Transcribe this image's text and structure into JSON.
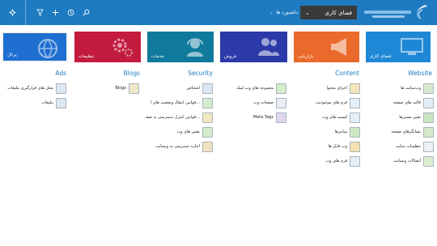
{
  "topbar": {
    "workspace_label": "فضای کاری",
    "dashboards_label": "داشبورد ها",
    "icons": [
      "settings-icon",
      "filter-icon",
      "add-icon",
      "history-icon",
      "search-icon"
    ],
    "colors": {
      "bar": "#1f7bc1",
      "workspace": "#3a3a3a"
    }
  },
  "tiles": [
    {
      "label": "فضای کاری",
      "color": "#1e88d6",
      "icon": "monitor-icon"
    },
    {
      "label": "بازاریابی",
      "color": "#ea6a2c",
      "icon": "megaphone-icon"
    },
    {
      "label": "فروش",
      "color": "#2b3aa8",
      "icon": "users-icon"
    },
    {
      "label": "خدمات",
      "color": "#0f7a9c",
      "icon": "headset-icon"
    },
    {
      "label": "تنظیمات",
      "color": "#c21b3e",
      "icon": "gears-icon"
    },
    {
      "label": "پرتال",
      "color": "#1e6fd0",
      "icon": "portal-icon"
    }
  ],
  "sections": {
    "website": {
      "title": "Website",
      "items": [
        "وب‌سایت ها",
        "قالب های صفحه",
        "تغییر مسیرها",
        "نشانگرهای صفحه",
        "تنظیمات سایت",
        "اتصالات وبسایت"
      ]
    },
    "content": {
      "title": "Content",
      "items": [
        "اجزای محتوا",
        "فرم های موجودیت",
        "لیست های وب",
        "میانبرها",
        "وب فایل ها",
        "فرم های وب"
      ],
      "items2": [
        "مجموعه های وب لینک",
        "صفحات وب",
        "Meta Tags"
      ]
    },
    "security": {
      "title": "Security",
      "items": [
        "اشخاص",
        "قوانین انتقال وضعیت های ا...",
        "قوانین کنترل دسترسی به صفـ...",
        "نقش های وب",
        "اجازه دسترسی به وبسایت"
      ]
    },
    "blogs": {
      "title": "Blogs",
      "items": [
        "Blogs"
      ]
    },
    "ads": {
      "title": "Ads",
      "items": [
        "محل های قرارگیری تبلیغات",
        "تبلیغات"
      ]
    }
  }
}
